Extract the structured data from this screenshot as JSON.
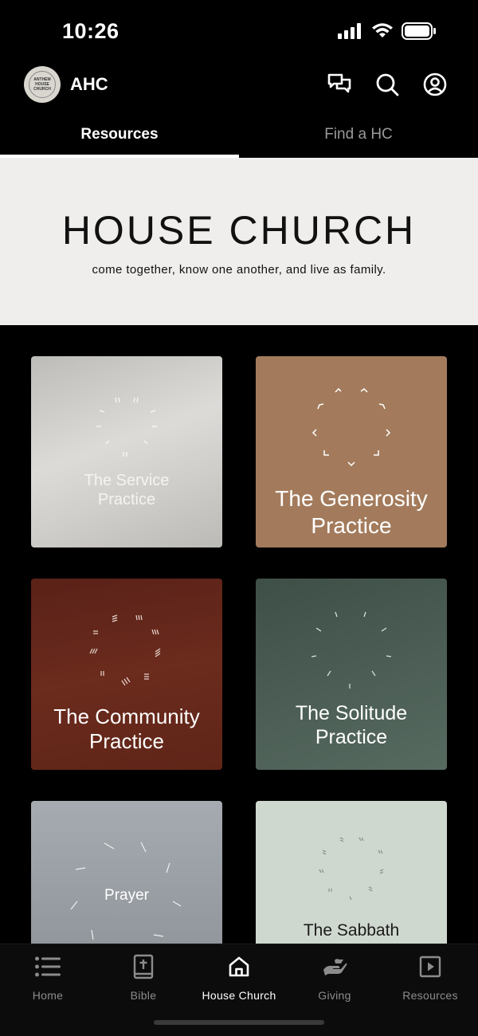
{
  "status_bar": {
    "time": "10:26"
  },
  "header": {
    "app_name": "AHC",
    "avatar_text": "ANTHEM HOUSE CHURCH"
  },
  "tabs": [
    {
      "label": "Resources",
      "active": true
    },
    {
      "label": "Find a HC",
      "active": false
    }
  ],
  "hero": {
    "title": "HOUSE CHURCH",
    "subtitle": "come together, know one another, and live as family."
  },
  "cards": [
    {
      "title": "The Service Practice",
      "line1": "The Service",
      "line2": "Practice",
      "color": "#cfcdca"
    },
    {
      "title": "The Generosity Practice",
      "line1": "The Generosity",
      "line2": "Practice",
      "color": "#a37b5c"
    },
    {
      "title": "The Community Practice",
      "line1": "The Community",
      "line2": "Practice",
      "color": "#632819"
    },
    {
      "title": "The Solitude Practice",
      "line1": "The Solitude",
      "line2": "Practice",
      "color": "#4a5c53"
    },
    {
      "title": "Prayer",
      "line1": "Prayer",
      "line2": "",
      "color": "#989ea3"
    },
    {
      "title": "The Sabbath",
      "line1": "The Sabbath",
      "line2": "",
      "color": "#cfd8cf"
    }
  ],
  "bottom_nav": [
    {
      "label": "Home",
      "icon": "list-icon",
      "active": false
    },
    {
      "label": "Bible",
      "icon": "bible-icon",
      "active": false
    },
    {
      "label": "House Church",
      "icon": "house-icon",
      "active": true
    },
    {
      "label": "Giving",
      "icon": "giving-hand-icon",
      "active": false
    },
    {
      "label": "Resources",
      "icon": "play-square-icon",
      "active": false
    }
  ]
}
